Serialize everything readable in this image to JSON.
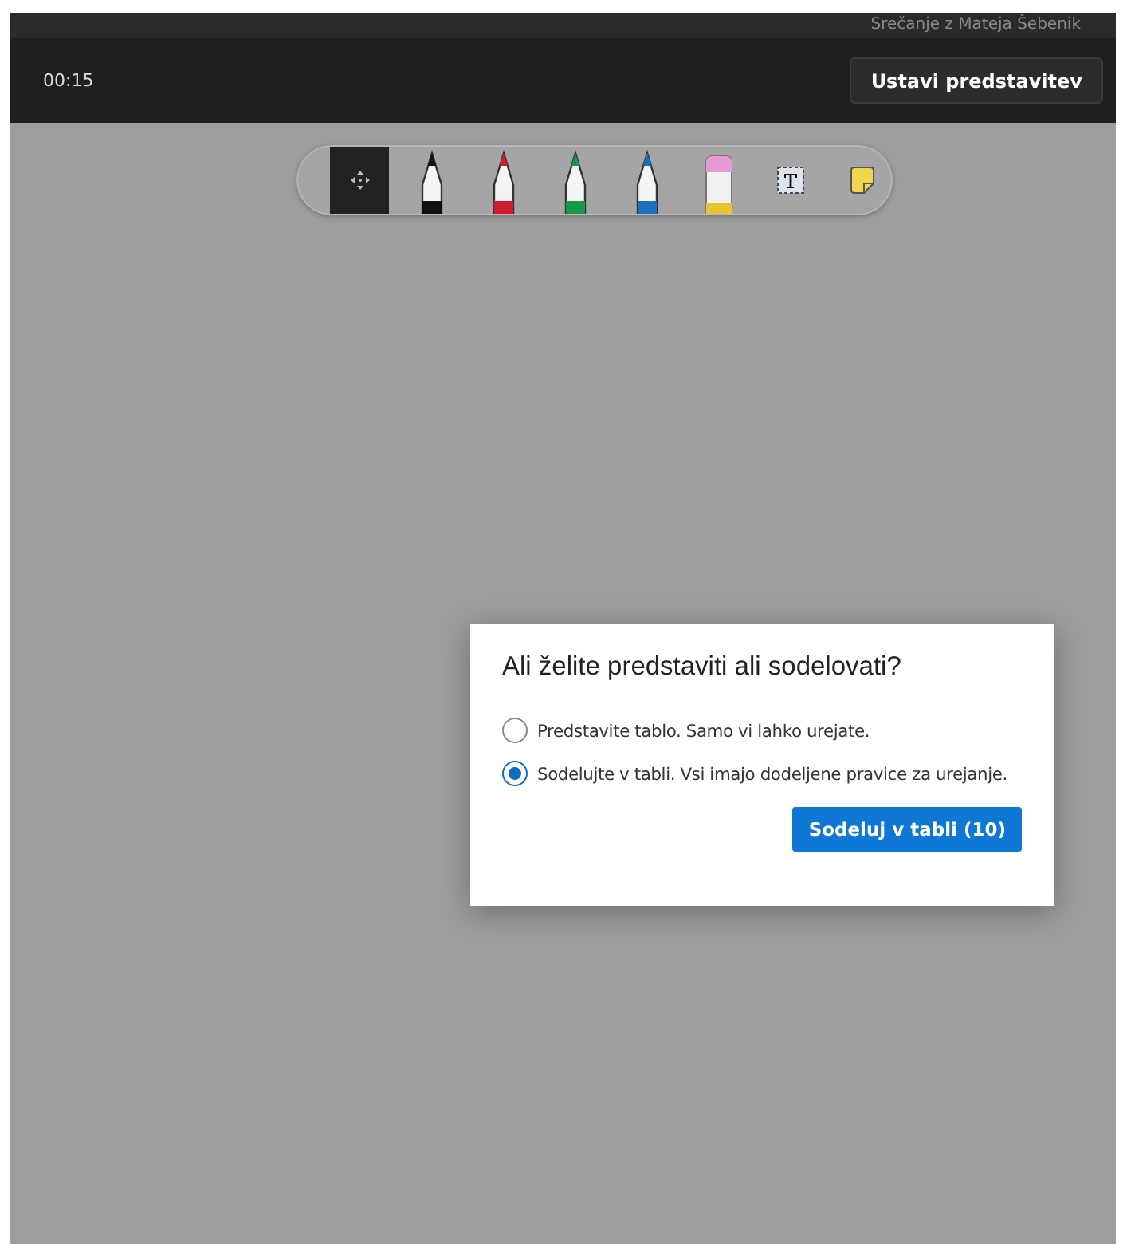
{
  "meeting_title": "Srečanje z Mateja Šebenik",
  "control_bar": {
    "timer": "00:15",
    "stop_button": "Ustavi predstavitev"
  },
  "toolbar": {
    "tools": [
      {
        "kind": "move",
        "selected": true
      },
      {
        "kind": "pen",
        "color": "#111111",
        "selected": false
      },
      {
        "kind": "pen",
        "color": "#d01c2c",
        "selected": false
      },
      {
        "kind": "pen",
        "color": "#159a4a",
        "selected": false
      },
      {
        "kind": "pen",
        "color": "#1f6fc0",
        "selected": false
      },
      {
        "kind": "eraser",
        "selected": false
      },
      {
        "kind": "text",
        "selected": false
      },
      {
        "kind": "note",
        "selected": false
      }
    ]
  },
  "dialog": {
    "title": "Ali želite predstaviti ali sodelovati?",
    "options": [
      {
        "label": "Predstavite tablo. Samo vi lahko urejate.",
        "selected": false
      },
      {
        "label": "Sodelujte v tabli. Vsi imajo dodeljene pravice za urejanje.",
        "selected": true
      }
    ],
    "button": "Sodeluj v tabli (10)"
  }
}
